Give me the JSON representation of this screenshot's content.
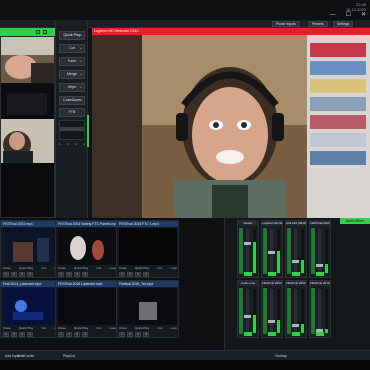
{
  "clock": {
    "time": "22:46",
    "date": "16.12.2020"
  },
  "window_controls": {
    "minimize": "—",
    "maximize": "☐",
    "close": "✕"
  },
  "toolbar": {
    "fullscreen": "Fullscreen",
    "power_inputs": "Power Inputs",
    "presets": "Presets",
    "settings": "Settings"
  },
  "transitions": {
    "items": [
      "Quick Play",
      "Cut",
      "Fade",
      "Merge",
      "Wipe",
      "CubeZoom"
    ],
    "ftb": "FTB",
    "numbers": [
      "1",
      "2",
      "3",
      "4"
    ]
  },
  "output": {
    "title": "Logitech HD Webcam C910"
  },
  "inputs": [
    {
      "title": "FESTival 2003.mp4",
      "number": "1"
    },
    {
      "title": "FESTival 2003 Variety FTC Panels.mp4",
      "number": "2"
    },
    {
      "title": "FESTival 2019 FTC 1.mp4",
      "number": "3"
    },
    {
      "title": "Fest 2014_Lavender.mp4",
      "number": "4"
    },
    {
      "title": "FESTival 2019 Lavender.mp4",
      "number": "5"
    },
    {
      "title": "Festival 2015_Tsv.mp4",
      "number": "6"
    }
  ],
  "input_buttons": [
    "Close",
    "Quick Play",
    "Cut",
    "Loop"
  ],
  "input_nums": [
    "1",
    "2",
    "3",
    "4"
  ],
  "mixer": {
    "tab": "Audio Mixer",
    "strips": [
      {
        "title": "Master",
        "level": 0.7
      },
      {
        "title": "Logitech HD Webc",
        "level": 0.5
      },
      {
        "title": "Call 202 (6649)",
        "level": 0.3
      },
      {
        "title": "FESTival 2019",
        "level": 0.2
      },
      {
        "title": "Audio Line",
        "level": 0.4
      },
      {
        "title": "FESTival 2003.mp",
        "level": 0.3
      },
      {
        "title": "FESTival 2002 Va",
        "level": 0.2
      },
      {
        "title": "FESTival 2019 FT",
        "level": 0.1
      }
    ]
  },
  "footer": {
    "add_input": "Add Input",
    "multicorder": "MultiCorder",
    "playlist": "PlayList",
    "overlay": "Overlay"
  },
  "colors": {
    "accent_green": "#2fd14a",
    "output_red": "#e0202a",
    "input_blue": "#1f3a66"
  }
}
